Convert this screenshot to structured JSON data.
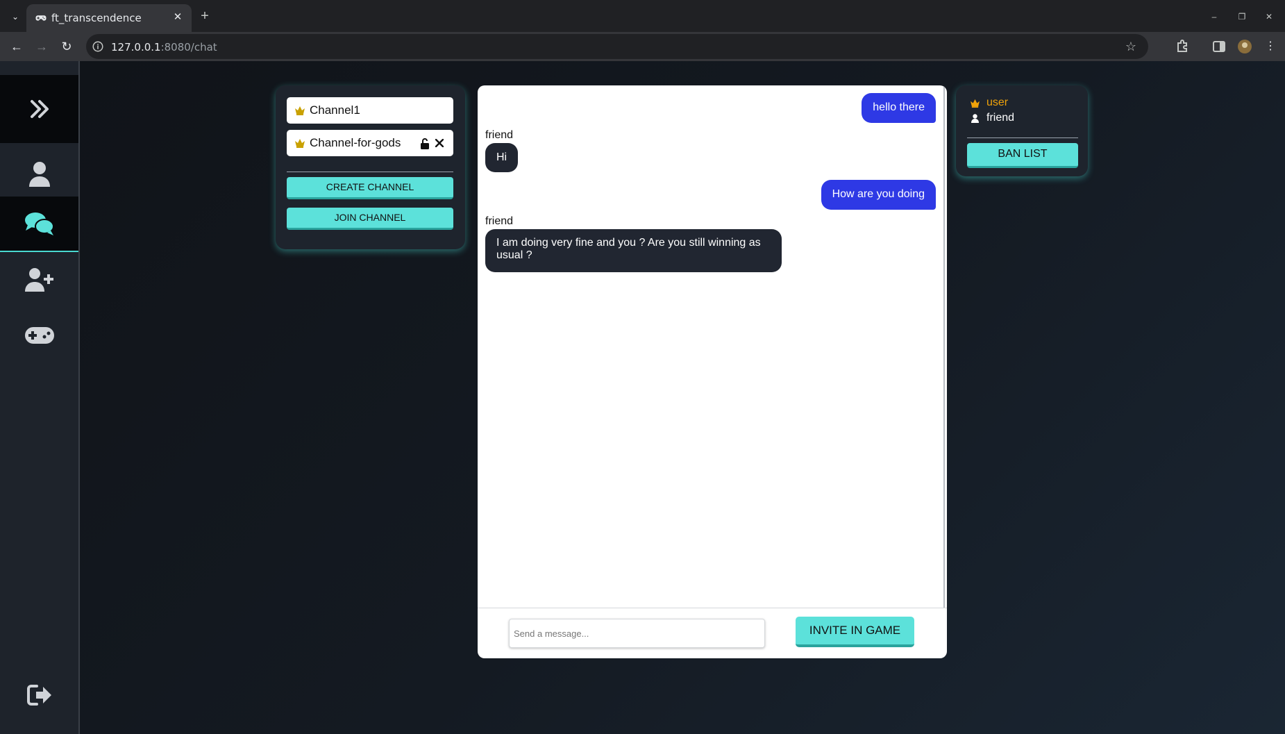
{
  "browser": {
    "tab_title": "ft_transcendence",
    "url_host": "127.0.0.1",
    "url_path": ":8080/chat"
  },
  "sidebar": {
    "items": [
      {
        "icon": "chevrons-right-icon"
      },
      {
        "icon": "user-icon"
      },
      {
        "icon": "chat-bubbles-icon",
        "active": true
      },
      {
        "icon": "add-user-icon"
      },
      {
        "icon": "gamepad-icon"
      },
      {
        "icon": "logout-icon"
      }
    ]
  },
  "channels": {
    "items": [
      {
        "name": "Channel1",
        "icon": "crown-icon"
      },
      {
        "name": "Channel-for-gods",
        "icon": "crown-icon",
        "actions": [
          "unlock-icon",
          "close-icon"
        ]
      }
    ],
    "create_label": "CREATE CHANNEL",
    "join_label": "JOIN CHANNEL"
  },
  "chat": {
    "messages": [
      {
        "from": "me",
        "text": "hello there"
      },
      {
        "from": "friend",
        "sender": "friend",
        "text": "Hi"
      },
      {
        "from": "me",
        "text": "How are you doing"
      },
      {
        "from": "friend",
        "sender": "friend",
        "text": "I am doing very fine and you ? Are you still winning as usual ?"
      }
    ],
    "input_placeholder": "Send a message...",
    "invite_label": "INVITE IN GAME"
  },
  "members": {
    "users": [
      {
        "name": "user",
        "icon": "crown-icon",
        "color": "#f0a30a"
      },
      {
        "name": "friend",
        "icon": "user-icon",
        "color": "#ffffff"
      }
    ],
    "ban_list_label": "BAN LIST"
  },
  "colors": {
    "accent": "#5ce1da",
    "outgoing_bubble": "#2e39e5",
    "incoming_bubble": "#212631",
    "owner": "#f0a30a"
  }
}
